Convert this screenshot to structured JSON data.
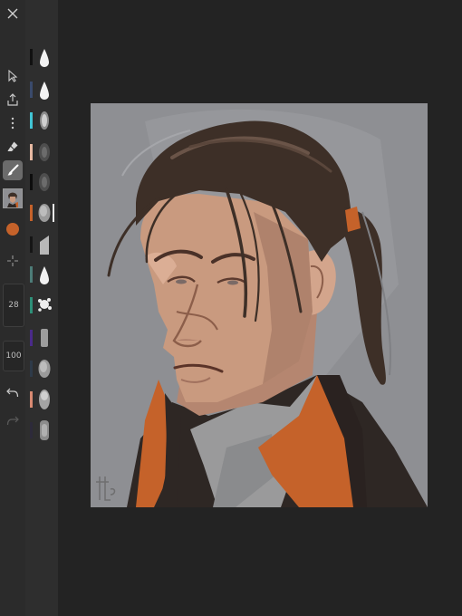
{
  "toolbar": {
    "items": [
      {
        "icon": "close-icon"
      },
      {
        "icon": "cursor-icon"
      },
      {
        "icon": "share-icon"
      },
      {
        "icon": "more-icon"
      },
      {
        "icon": "eraser-icon"
      },
      {
        "icon": "brush-icon",
        "active": true
      },
      {
        "icon": "layer-thumbnail"
      },
      {
        "icon": "color-swatch",
        "color": "#c5622a"
      },
      {
        "icon": "crosshair-icon"
      },
      {
        "icon": "undo-icon"
      },
      {
        "icon": "redo-icon",
        "disabled": true
      }
    ],
    "brush_size": "28",
    "opacity": "100"
  },
  "brushes": [
    {
      "color": "#111111",
      "shape": "drop"
    },
    {
      "color": "#3a4a6b",
      "shape": "drop"
    },
    {
      "color": "#41c4d4",
      "shape": "soft"
    },
    {
      "color": "#e7b9a2",
      "shape": "soft-dark"
    },
    {
      "color": "#0d0d0d",
      "shape": "soft-dark"
    },
    {
      "color": "#c5622a",
      "shape": "round",
      "selected": true
    },
    {
      "color": "#151515",
      "shape": "chisel"
    },
    {
      "color": "#4d7c78",
      "shape": "drop"
    },
    {
      "color": "#2e8f78",
      "shape": "splatter"
    },
    {
      "color": "#4a2a8a",
      "shape": "flat"
    },
    {
      "color": "#2e3a48",
      "shape": "round"
    },
    {
      "color": "#d88a72",
      "shape": "blend"
    },
    {
      "color": "#2d2a3a",
      "shape": "texture"
    }
  ],
  "colors": {
    "canvas_bg": "#8e8f93",
    "accent": "#c5622a",
    "hair": "#3d2f27",
    "skin": "#c99a7f",
    "coat": "#2e2724",
    "collar": "#c5622a"
  }
}
